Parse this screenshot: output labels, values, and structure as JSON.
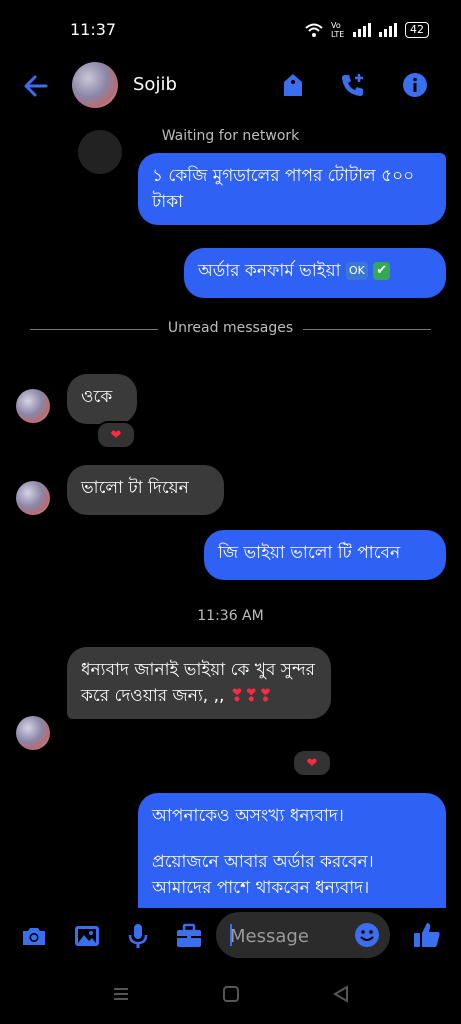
{
  "status_bar": {
    "time": "11:37",
    "lte": "Vo LTE",
    "battery": "42"
  },
  "header": {
    "contact_name": "Sojib"
  },
  "network_status": "Waiting for network",
  "divider_label": "Unread messages",
  "timestamp": "11:36 AM",
  "messages": [
    {
      "sender": "me",
      "text": "১ কেজি মুগডালের পাপর টোটাল ৫০০ টাকা"
    },
    {
      "sender": "me",
      "text": "অর্ডার কনফার্ম ভাইয়া",
      "emoji_ok": "OK",
      "emoji_check": "✔"
    },
    {
      "sender": "them",
      "text": "ওকে",
      "reaction": "❤"
    },
    {
      "sender": "them",
      "text": "ভালো টা দিয়েন"
    },
    {
      "sender": "me",
      "text": "জি ভাইয়া ভালো টি পাবেন"
    },
    {
      "sender": "them",
      "text": "ধন্যবাদ জানাই ভাইয়া কে খুব সুন্দর করে দেওয়ার জন্য, ,,",
      "hearts": "❣❣❣",
      "reaction": "❤"
    },
    {
      "sender": "me",
      "line1": "আপনাকেও অসংখ্য ধন্যবাদ।",
      "line2": "প্রয়োজনে আবার অর্ডার করবেন।",
      "line3": "আমাদের পাশে থাকবেন ধন্যবাদ।"
    }
  ],
  "composer": {
    "placeholder": "Message"
  },
  "colors": {
    "accent": "#2f61f5",
    "background": "#000000",
    "incoming_bubble": "#3a3a3a",
    "reaction": "#ff2a44"
  },
  "icons": [
    "back-arrow-icon",
    "tag-icon",
    "add-call-icon",
    "info-icon",
    "camera-icon",
    "gallery-icon",
    "microphone-icon",
    "briefcase-icon",
    "emoji-icon",
    "thumbs-up-icon",
    "menu-nav-icon",
    "home-nav-icon",
    "back-nav-icon"
  ]
}
